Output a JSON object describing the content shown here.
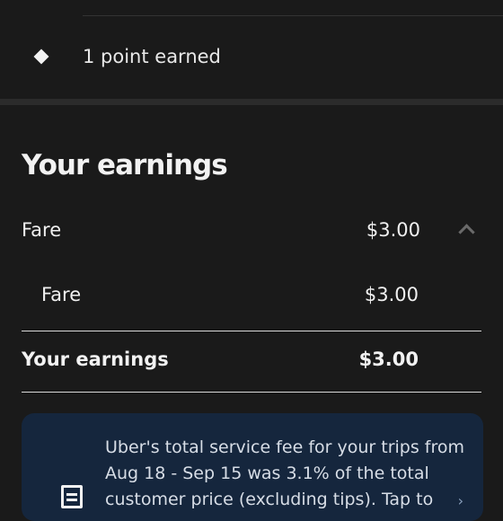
{
  "points": {
    "text": "1 point earned"
  },
  "earnings": {
    "title": "Your earnings",
    "fare_row": {
      "label": "Fare",
      "value": "$3.00"
    },
    "fare_sub_row": {
      "label": "Fare",
      "value": "$3.00"
    },
    "total_row": {
      "label": "Your earnings",
      "value": "$3.00"
    }
  },
  "info_card": {
    "text": "Uber's total service fee for your trips from Aug 18 - Sep 15 was 3.1% of the total customer price (excluding tips). Tap to",
    "arrow": "›"
  }
}
